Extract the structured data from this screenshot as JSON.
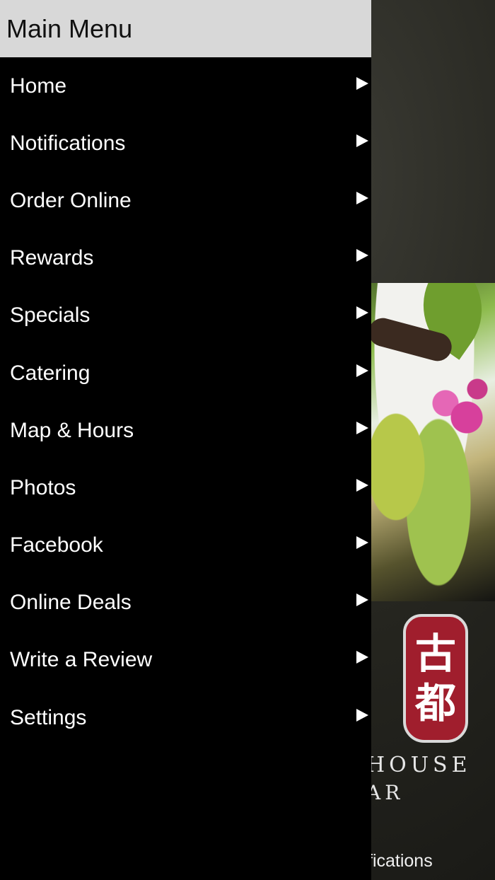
{
  "drawer": {
    "title": "Main Menu",
    "items": [
      {
        "label": "Home",
        "icon": "arrow-right-icon"
      },
      {
        "label": "Notifications",
        "icon": "arrow-right-icon"
      },
      {
        "label": "Order Online",
        "icon": "arrow-right-icon"
      },
      {
        "label": "Rewards",
        "icon": "arrow-right-icon"
      },
      {
        "label": "Specials",
        "icon": "arrow-right-icon"
      },
      {
        "label": "Catering",
        "icon": "arrow-right-icon"
      },
      {
        "label": "Map & Hours",
        "icon": "arrow-right-icon"
      },
      {
        "label": "Photos",
        "icon": "arrow-right-icon"
      },
      {
        "label": "Facebook",
        "icon": "arrow-right-icon"
      },
      {
        "label": "Online Deals",
        "icon": "arrow-right-icon"
      },
      {
        "label": "Write a Review",
        "icon": "arrow-right-icon"
      },
      {
        "label": "Settings",
        "icon": "arrow-right-icon"
      }
    ]
  },
  "background": {
    "logo": {
      "glyphs": [
        "古",
        "都"
      ],
      "text_line1": "HOUSE",
      "text_line2": "AR"
    },
    "bottom_tab_text": "fications"
  },
  "colors": {
    "header_bg": "#d8d8d8",
    "drawer_bg": "#000000",
    "logo_red": "#a01e2d"
  }
}
